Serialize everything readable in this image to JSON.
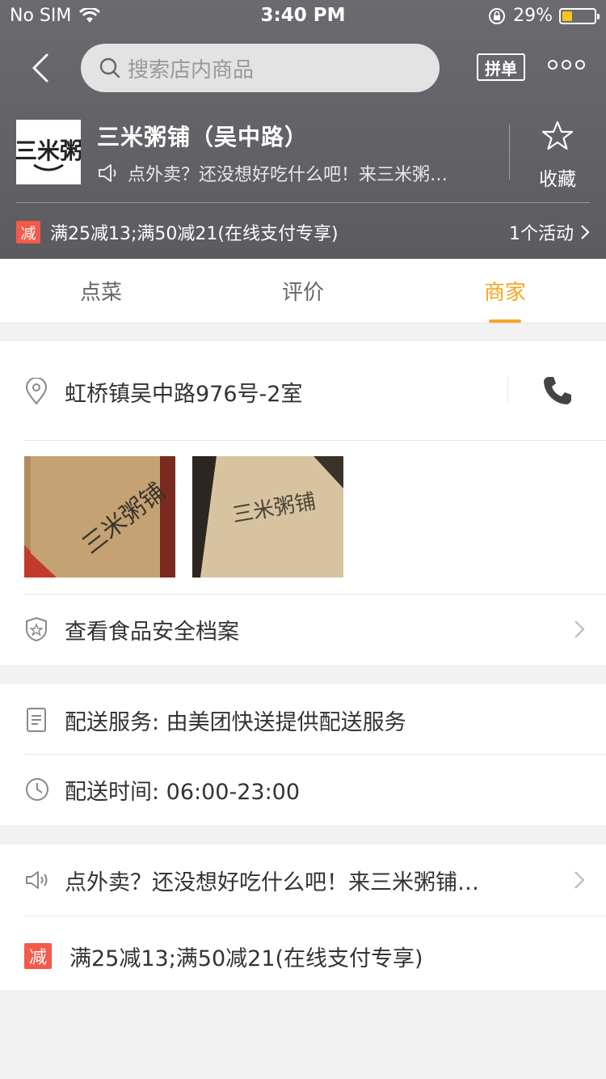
{
  "status_bar": {
    "carrier": "No SIM",
    "time": "3:40 PM",
    "battery": "29%",
    "battery_level": 0.29
  },
  "nav": {
    "search_placeholder": "搜索店内商品",
    "pindan_label": "拼单"
  },
  "store": {
    "name": "三米粥铺（吴中路）",
    "notice": "点外卖？还没想好吃什么吧！来三米粥…",
    "favorite_label": "收藏",
    "promo_badge": "减",
    "promo_text": "满25减13;满50减21(在线支付专享)",
    "activity_count": "1个活动"
  },
  "tabs": [
    {
      "label": "点菜"
    },
    {
      "label": "评价"
    },
    {
      "label": "商家"
    }
  ],
  "merchant": {
    "address": "虹桥镇吴中路976号-2室",
    "food_safety": "查看食品安全档案",
    "delivery_service": "配送服务: 由美团快送提供配送服务",
    "delivery_time": "配送时间:  06:00-23:00",
    "announcement": "点外卖？还没想好吃什么吧！来三米粥铺…",
    "promo_badge": "减",
    "promo_text": "满25减13;满50减21(在线支付专享)"
  },
  "colors": {
    "accent": "#f6a623",
    "promo_red": "#f35a4a",
    "header": "#5f5f64"
  }
}
